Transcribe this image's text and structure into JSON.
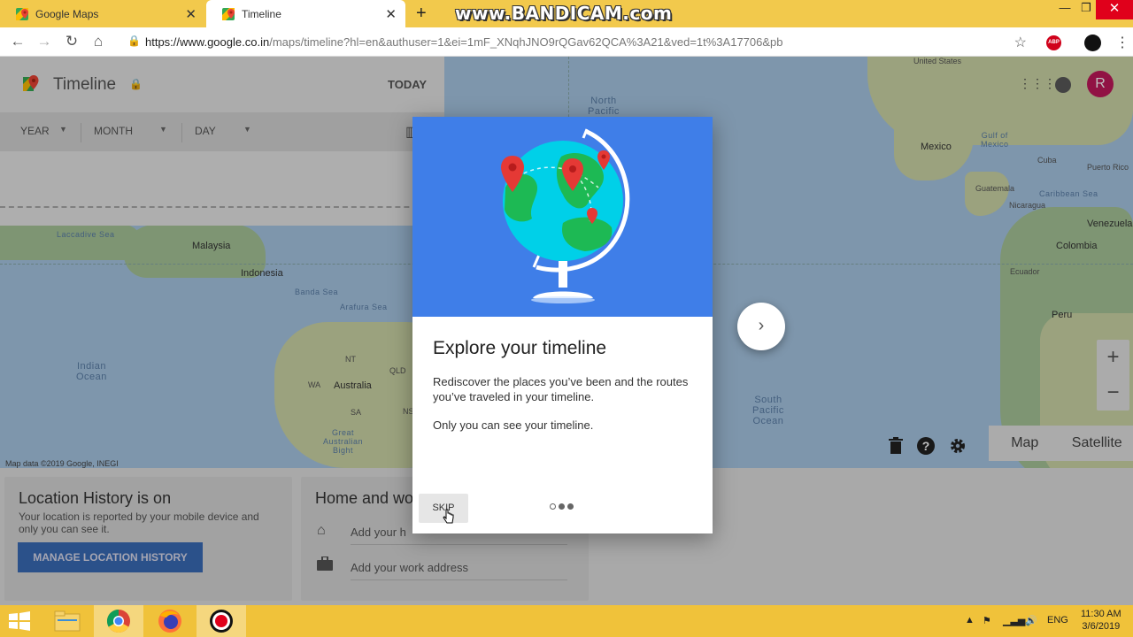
{
  "browser": {
    "tabs": [
      {
        "label": "Google Maps",
        "active": false
      },
      {
        "label": "Timeline",
        "active": true
      }
    ],
    "url_prefix": "https://www.google.co.in",
    "url_path": "/maps/timeline?hl=en&authuser=1&ei=1mF_XNqhJNO9rQGav62QCA%3A21&ved=1t%3A17706&pb",
    "watermark": "www.BANDICAM.com",
    "abp_label": "ABP"
  },
  "timeline": {
    "title": "Timeline",
    "today_label": "TODAY",
    "filters": [
      "YEAR",
      "MONTH",
      "DAY"
    ]
  },
  "account": {
    "avatar_letter": "R"
  },
  "map": {
    "labels": {
      "north_pacific": "North\nPacific",
      "united_states": "United States",
      "mexico": "Mexico",
      "gulf_mexico": "Gulf of\nMexico",
      "cuba": "Cuba",
      "puerto_rico": "Puerto Rico",
      "guatemala": "Guatemala",
      "caribbean": "Caribbean Sea",
      "nicaragua": "Nicaragua",
      "venezuela": "Venezuela",
      "colombia": "Colombia",
      "ecuador": "Ecuador",
      "peru": "Peru",
      "south_pacific": "South\nPacific\nOcean",
      "lacadive": "Laccadive Sea",
      "malaysia": "Malaysia",
      "indonesia": "Indonesia",
      "banda": "Banda Sea",
      "arafura": "Arafura Sea",
      "indian_ocean": "Indian\nOcean",
      "australia": "Australia",
      "nt": "NT",
      "qld": "QLD",
      "wa": "WA",
      "sa": "SA",
      "nsw": "NSW",
      "great_australian_bight": "Great\nAustralian\nBight"
    },
    "attribution": "Map data ©2019 Google, INEGI",
    "map_types": [
      "Map",
      "Satellite"
    ]
  },
  "cards": {
    "location_history": {
      "title": "Location History is on",
      "text": "Your location is reported by your mobile device and only you can see it.",
      "button": "MANAGE LOCATION HISTORY"
    },
    "home_work": {
      "title": "Home and wo",
      "home_placeholder": "Add your h",
      "work_placeholder": "Add your work address"
    }
  },
  "modal": {
    "title": "Explore your timeline",
    "text1": "Rediscover the places you’ve been and the routes you’ve traveled in your timeline.",
    "text2": "Only you can see your timeline.",
    "skip_label": "SKIP",
    "step": 1,
    "step_count": 3
  },
  "taskbar": {
    "language": "ENG",
    "time": "11:30 AM",
    "date": "3/6/2019"
  },
  "colors": {
    "tabbar": "#f2c94c",
    "hero": "#3f7ee8",
    "avatar": "#c2185b",
    "button": "#3a6db9"
  }
}
